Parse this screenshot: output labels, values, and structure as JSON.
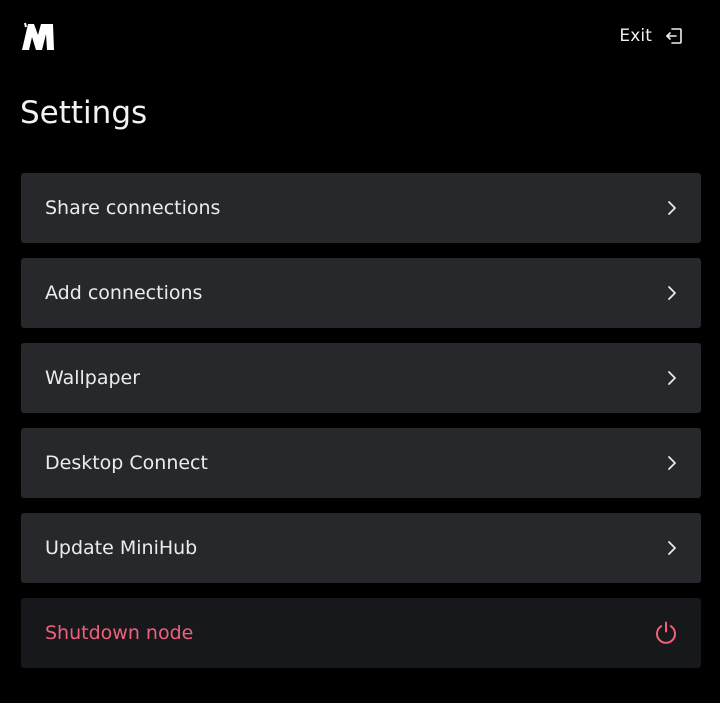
{
  "app": {
    "logo_name": "minihub-logo",
    "accent_danger": "#f0607a",
    "background": "#000000",
    "card_background": "#26282b"
  },
  "header": {
    "exit_label": "Exit",
    "exit_icon": "exit-icon"
  },
  "page": {
    "title": "Settings"
  },
  "menu": {
    "items": [
      {
        "label": "Share connections",
        "icon": "chevron-right-icon"
      },
      {
        "label": "Add connections",
        "icon": "chevron-right-icon"
      },
      {
        "label": "Wallpaper",
        "icon": "chevron-right-icon"
      },
      {
        "label": "Desktop Connect",
        "icon": "chevron-right-icon"
      },
      {
        "label": "Update MiniHub",
        "icon": "chevron-right-icon"
      }
    ],
    "shutdown": {
      "label": "Shutdown node",
      "icon": "power-icon"
    }
  }
}
